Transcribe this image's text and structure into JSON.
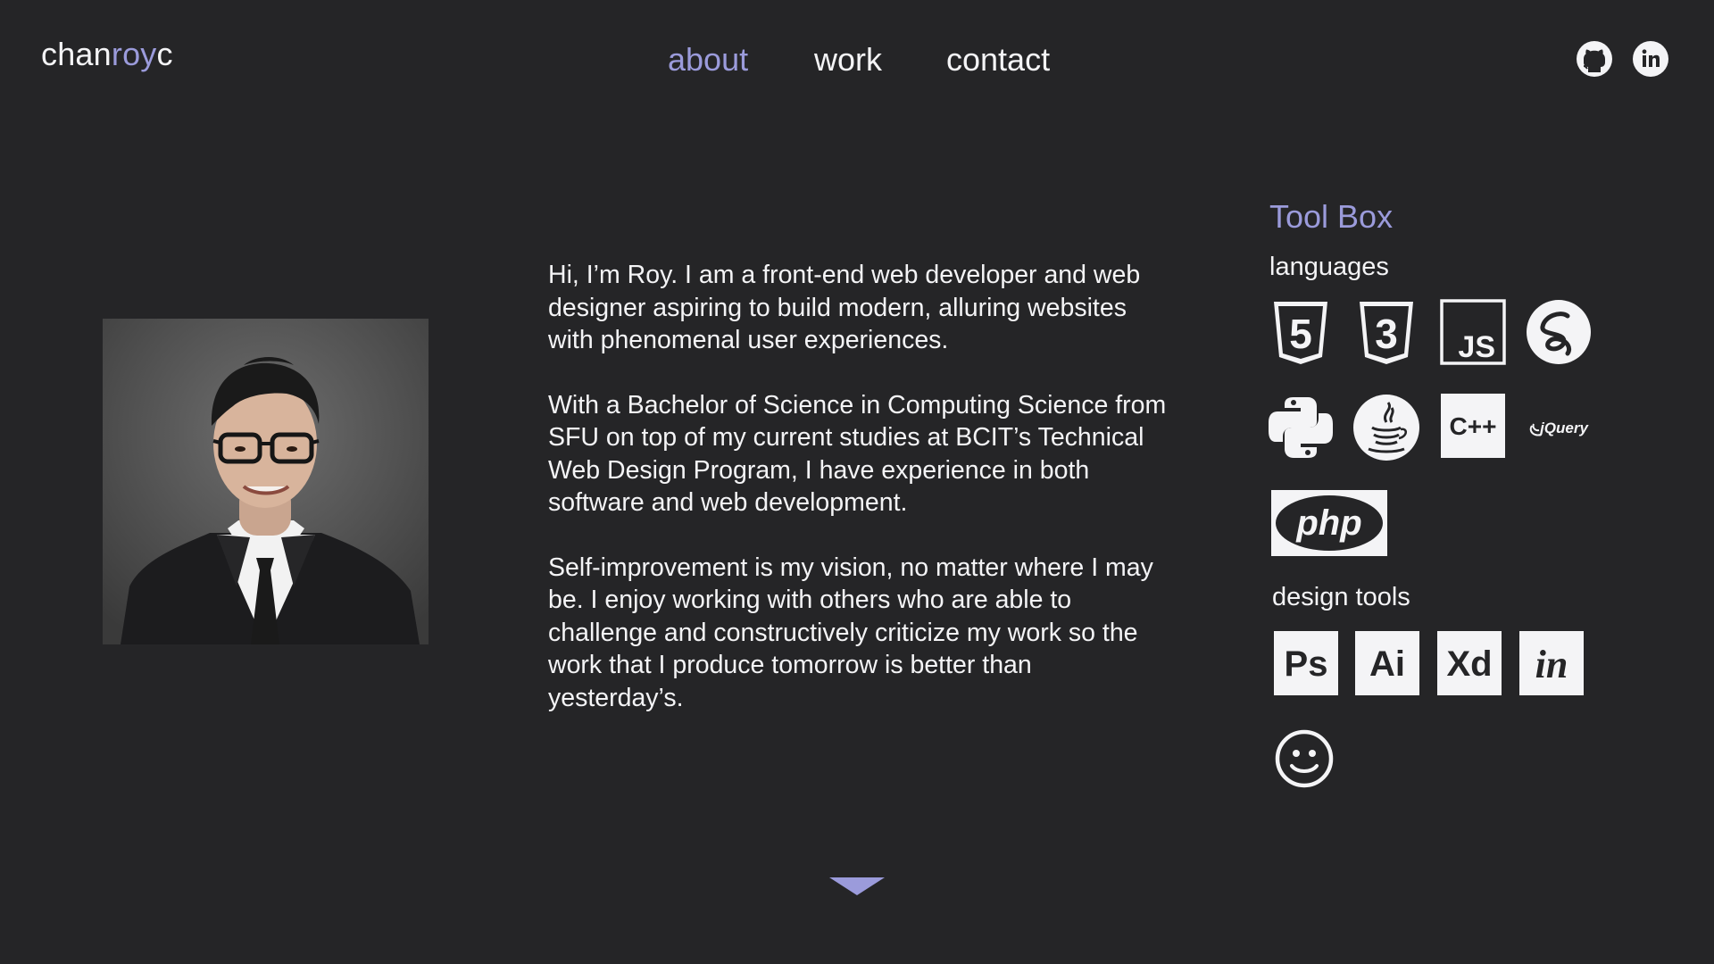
{
  "header": {
    "logo": {
      "part1": "chan",
      "part2": "roy",
      "part3": "c"
    },
    "nav": [
      {
        "label": "about",
        "active": true
      },
      {
        "label": "work",
        "active": false
      },
      {
        "label": "contact",
        "active": false
      }
    ],
    "social": [
      {
        "icon": "github-icon"
      },
      {
        "icon": "linkedin-icon"
      }
    ]
  },
  "about": {
    "portrait_icon": "profile-photo",
    "paragraphs": [
      "Hi, I’m Roy. I am a front-end web developer and web designer aspiring to build modern, alluring websites with phenomenal user experiences.",
      "With a Bachelor of Science in Computing Science from SFU on top of my current studies at BCIT’s Technical Web Design Program, I have experience in both software and web development.",
      "Self-improvement is my vision, no matter where I may be. I enjoy working with others who are able to challenge and constructively criticize my work so the work that I produce tomorrow is better than yesterday’s."
    ]
  },
  "toolbox": {
    "title": "Tool Box",
    "languages_heading": "languages",
    "languages": [
      {
        "icon": "html5-icon",
        "text": "5"
      },
      {
        "icon": "css3-icon",
        "text": "3"
      },
      {
        "icon": "javascript-icon",
        "text": "JS"
      },
      {
        "icon": "sass-icon"
      },
      {
        "icon": "python-icon"
      },
      {
        "icon": "java-icon"
      },
      {
        "icon": "cplusplus-icon",
        "text": "C++"
      },
      {
        "icon": "jquery-icon",
        "text": "jQuery"
      },
      {
        "icon": "php-icon",
        "text": "php"
      }
    ],
    "design_heading": "design tools",
    "design_tools": [
      {
        "icon": "photoshop-icon",
        "text": "Ps"
      },
      {
        "icon": "illustrator-icon",
        "text": "Ai"
      },
      {
        "icon": "xd-icon",
        "text": "Xd"
      },
      {
        "icon": "invision-icon",
        "text": "in"
      },
      {
        "icon": "balsamiq-icon"
      }
    ]
  },
  "scroll": {
    "icon": "chevron-down-icon"
  },
  "colors": {
    "background": "#252527",
    "accent": "#9b9bdb",
    "text": "#f4f4f6"
  }
}
